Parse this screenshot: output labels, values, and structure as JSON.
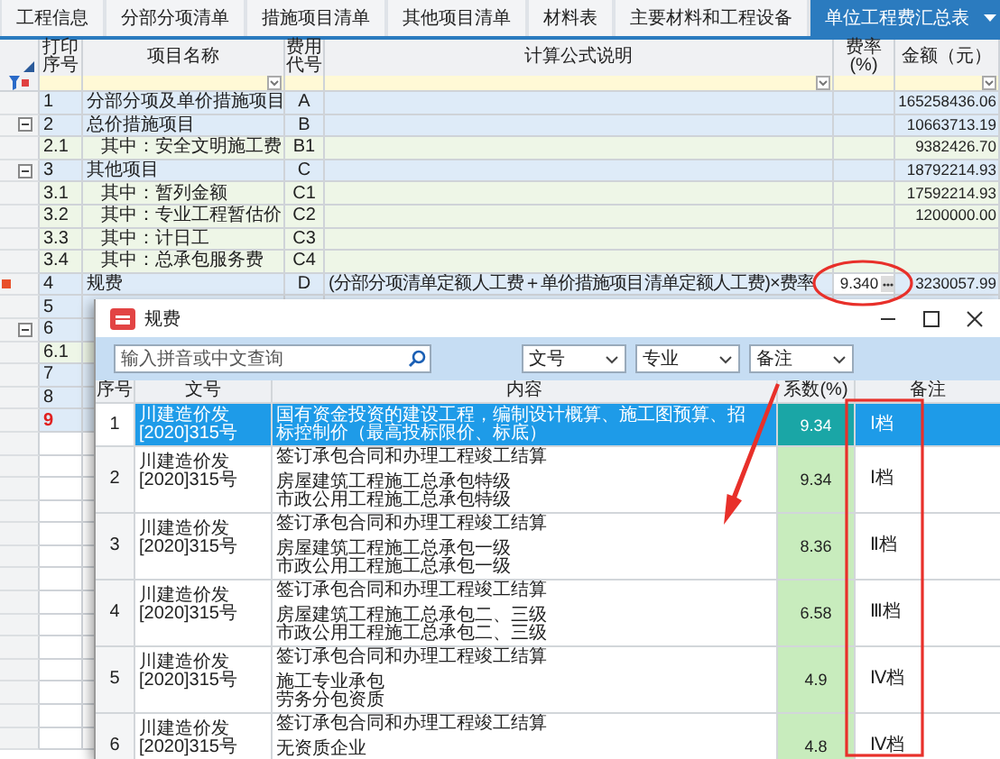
{
  "tabs": [
    {
      "label": "工程信息",
      "selected": false
    },
    {
      "label": "分部分项清单",
      "selected": false
    },
    {
      "label": "措施项目清单",
      "selected": false
    },
    {
      "label": "其他项目清单",
      "selected": false
    },
    {
      "label": "材料表",
      "selected": false
    },
    {
      "label": "主要材料和工程设备",
      "selected": false
    },
    {
      "label": "单位工程费汇总表",
      "selected": true
    }
  ],
  "grid": {
    "columns": [
      "打印序号",
      "项目名称",
      "费用代号",
      "计算公式说明",
      "费率(%)",
      "金额（元）"
    ],
    "rows": [
      {
        "seq": "1",
        "name": "分部分项及单价措施项目",
        "code": "A",
        "amount": "165258436.06",
        "selected": false
      },
      {
        "seq": "2",
        "name": "总价措施项目",
        "code": "B",
        "amount": "10663713.19",
        "selected": false,
        "expanded": true,
        "children": [
          {
            "seq": "2.1",
            "name": "其中：安全文明施工费",
            "code": "B1",
            "amount": "9382426.70",
            "selected": false
          }
        ]
      },
      {
        "seq": "3",
        "name": "其他项目",
        "code": "C",
        "amount": "18792214.93",
        "selected": false,
        "expanded": true,
        "children": [
          {
            "seq": "3.1",
            "name": "其中：暂列金额",
            "code": "C1",
            "amount": "17592214.93",
            "selected": false
          },
          {
            "seq": "3.2",
            "name": "其中：专业工程暂估价",
            "code": "C2",
            "amount": "1200000.00",
            "selected": false
          },
          {
            "seq": "3.3",
            "name": "其中：计日工",
            "code": "C3",
            "selected": false
          },
          {
            "seq": "3.4",
            "name": "其中：总承包服务费",
            "code": "C4",
            "selected": false
          }
        ]
      },
      {
        "seq": "4",
        "name": "规费",
        "code": "D",
        "formula": "(分部分项清单定额人工费＋单价措施项目清单定额人工费)×费率",
        "rate": "9.340",
        "amount": "3230057.99",
        "selected": true
      },
      {
        "seq": "5",
        "selected": false
      },
      {
        "seq": "6",
        "selected": false,
        "expanded": true,
        "children": [
          {
            "seq": "6.1",
            "selected": false
          }
        ]
      },
      {
        "seq": "7",
        "selected": false
      },
      {
        "seq": "8",
        "selected": false
      },
      {
        "seq": "9",
        "selected": false
      }
    ]
  },
  "dialog": {
    "title": "规费",
    "search": {
      "placeholder": "输入拼音或中文查询"
    },
    "filters": [
      "文号",
      "专业",
      "备注"
    ],
    "columns": [
      "序号",
      "文号",
      "内容",
      "系数(%)",
      "备注"
    ],
    "rows": [
      {
        "no": "1",
        "doc": "川建造价发[2020]315号",
        "content": [
          "国有资金投资的建设工程，编制设计概算、施工图预算、招标控制价（最高投标限价、标底）"
        ],
        "coef": "9.34",
        "note": "Ⅰ档",
        "selected": true
      },
      {
        "no": "2",
        "doc": "川建造价发[2020]315号",
        "content": [
          "签订承包合同和办理工程竣工结算",
          "房屋建筑工程施工总承包特级",
          "市政公用工程施工总承包特级"
        ],
        "coef": "9.34",
        "note": "Ⅰ档",
        "selected": false
      },
      {
        "no": "3",
        "doc": "川建造价发[2020]315号",
        "content": [
          "签订承包合同和办理工程竣工结算",
          "房屋建筑工程施工总承包一级",
          "市政公用工程施工总承包一级"
        ],
        "coef": "8.36",
        "note": "Ⅱ档",
        "selected": false
      },
      {
        "no": "4",
        "doc": "川建造价发[2020]315号",
        "content": [
          "签订承包合同和办理工程竣工结算",
          "房屋建筑工程施工总承包二、三级",
          "市政公用工程施工总承包二、三级"
        ],
        "coef": "6.58",
        "note": "Ⅲ档",
        "selected": false
      },
      {
        "no": "5",
        "doc": "川建造价发[2020]315号",
        "content": [
          "签订承包合同和办理工程竣工结算",
          "施工专业承包",
          "劳务分包资质"
        ],
        "coef": "4.9",
        "note": "Ⅳ档",
        "selected": false
      },
      {
        "no": "6",
        "doc": "川建造价发[2020]315号",
        "content": [
          "签订承包合同和办理工程竣工结算",
          "无资质企业"
        ],
        "coef": "4.8",
        "note": "Ⅳ档",
        "selected": false
      }
    ]
  }
}
